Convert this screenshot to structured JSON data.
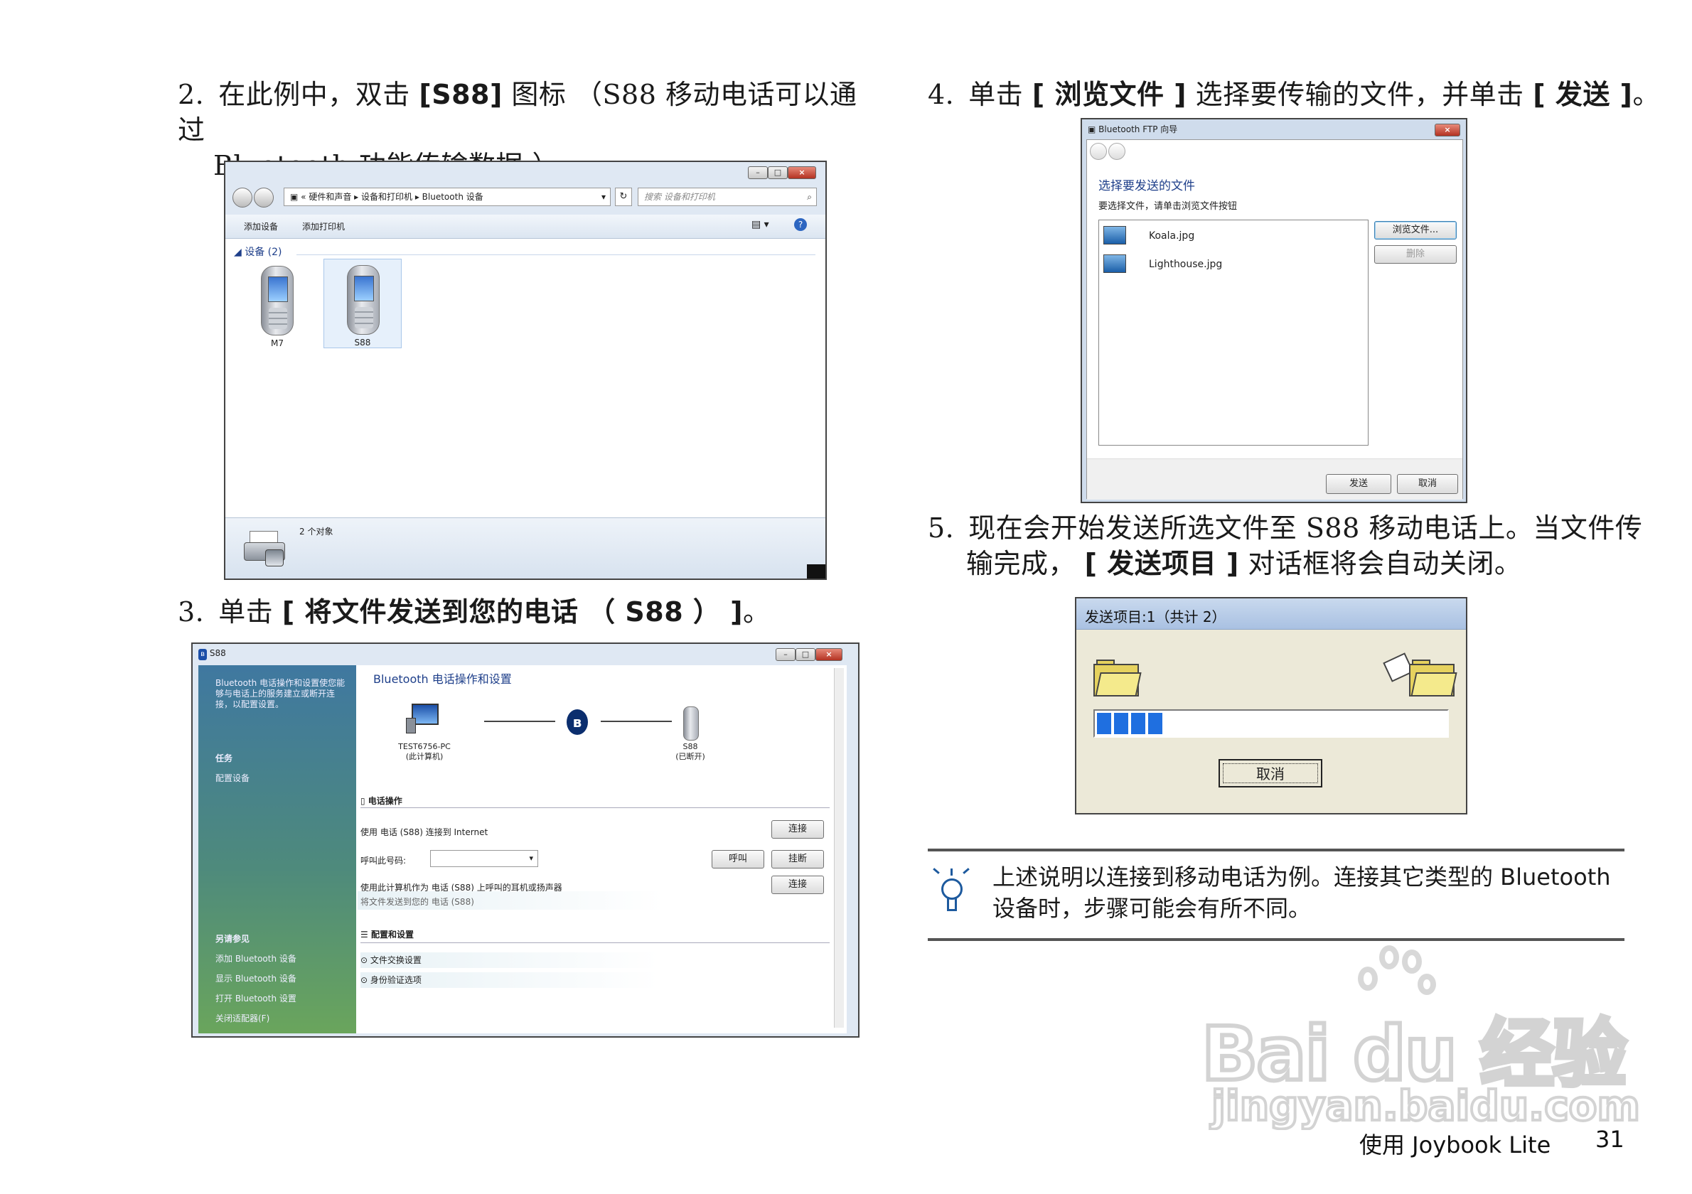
{
  "steps": {
    "s2": {
      "num": "2.",
      "t1": "在此例中，双击 ",
      "b1": "[S88]",
      "t2": " 图标 （",
      "t3": "S88",
      "t4": " 移动电话可以通过",
      "t5": "Bluetooth",
      "t6": " 功能传输数据 ）。"
    },
    "s3": {
      "num": "3.",
      "t1": "单击 ",
      "b1": "[ 将文件发送到您的电话 （ S88 ） ]",
      "t2": "。"
    },
    "s4": {
      "num": "4.",
      "t1": "单击 ",
      "b1": "[ 浏览文件 ]",
      "t2": " 选择要传输的文件，并单击 ",
      "b2": "[ 发送 ]",
      "t3": "。"
    },
    "s5": {
      "num": "5.",
      "t1": "现在会开始发送所选文件至 ",
      "t2": "S88",
      "t3": " 移动电话上。当文件传",
      "t4": "输完成， ",
      "b1": "[ 发送项目 ]",
      "t5": " 对话框将会自动关闭。"
    }
  },
  "explorer": {
    "breadcrumb_prefix": "«",
    "crumb1": "硬件和声音",
    "crumb2": "设备和打印机",
    "crumb3": "Bluetooth 设备",
    "search_placeholder": "搜索 设备和打印机",
    "toolbar_add_device": "添加设备",
    "toolbar_add_printer": "添加打印机",
    "group_header": "设备 (2)",
    "devices": [
      "M7",
      "S88"
    ],
    "status": "2 个对象"
  },
  "bt_panel": {
    "title": "S88",
    "sidebar_desc": "Bluetooth 电话操作和设置使您能够与电话上的服务建立或断开连接，以配置设置。",
    "task_header": "任务",
    "task_item": "配置设备",
    "see_also_header": "另请参见",
    "see_also": [
      "添加 Bluetooth 设备",
      "显示 Bluetooth 设备",
      "打开 Bluetooth 设置",
      "关闭适配器(F)"
    ],
    "heading": "Bluetooth 电话操作和设置",
    "pc_name": "TEST6756-PC",
    "pc_sub": "(此计算机)",
    "phone_name": "S88",
    "phone_sub": "(已断开)",
    "phone_ops_header": "电话操作",
    "op1": "使用 电话 (S88) 连接到 Internet",
    "connect": "连接",
    "call_label": "呼叫此号码:",
    "call": "呼叫",
    "hangup": "挂断",
    "op3": "使用此计算机作为 电话 (S88) 上呼叫的耳机或扬声器",
    "op4": "将文件发送到您的 电话 (S88)",
    "config_header": "配置和设置",
    "config1": "文件交换设置",
    "config2": "身份验证选项"
  },
  "ftp": {
    "title": "Bluetooth FTP 向导",
    "heading": "选择要发送的文件",
    "instruction": "要选择文件，请单击浏览文件按钮",
    "files": [
      "Koala.jpg",
      "Lighthouse.jpg"
    ],
    "browse": "浏览文件...",
    "delete": "删除",
    "send": "发送",
    "cancel": "取消"
  },
  "send_dialog": {
    "title": "发送项目:1（共计 2）",
    "progress_fraction": 0.2,
    "cancel": "取消"
  },
  "note": {
    "line1": "上述说明以连接到移动电话为例。连接其它类型的 Bluetooth",
    "line2": "设备时，步骤可能会有所不同。"
  },
  "watermark": {
    "brand": "Bai du 经验",
    "url": "jingyan.baidu.com"
  },
  "footer": {
    "section": "使用 Joybook Lite",
    "page": "31"
  },
  "colors": {
    "sidebar": "#4e8a7c",
    "progress": "#1f6fe0",
    "folder": "#e6d25e"
  }
}
